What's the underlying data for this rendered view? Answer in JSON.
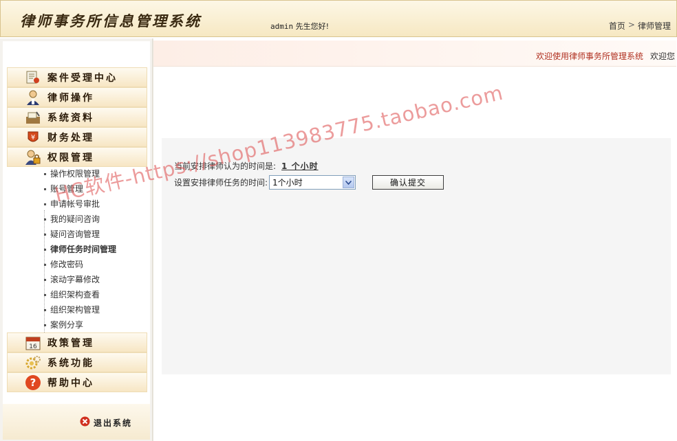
{
  "header": {
    "title": "律师事务所信息管理系统",
    "greeting_user": "admin",
    "greeting_text": "先生您好!",
    "breadcrumb": {
      "home": "首页",
      "separator": ">",
      "current": "律师管理"
    }
  },
  "sidebar": {
    "menus": [
      {
        "label": "案件受理中心",
        "icon": "case-icon"
      },
      {
        "label": "律师操作",
        "icon": "lawyer-icon"
      },
      {
        "label": "系统资料",
        "icon": "system-data-icon"
      },
      {
        "label": "财务处理",
        "icon": "finance-icon"
      },
      {
        "label": "权限管理",
        "icon": "permission-icon"
      },
      {
        "label": "政策管理",
        "icon": "calendar-icon"
      },
      {
        "label": "系统功能",
        "icon": "gear-icon"
      },
      {
        "label": "帮助中心",
        "icon": "help-icon"
      }
    ],
    "submenu": [
      "操作权限管理",
      "账号管理",
      "申请帐号审批",
      "我的疑问咨询",
      "疑问咨询管理",
      "律师任务时间管理",
      "修改密码",
      "滚动字幕修改",
      "组织架构查看",
      "组织架构管理",
      "案例分享"
    ],
    "active_submenu": "律师任务时间管理",
    "logout_label": "退出系统"
  },
  "main": {
    "marquee_text": "欢迎使用律师事务所管理系统",
    "marquee_more": "欢迎您",
    "current_label": "当前安排律师认为的时间是:",
    "current_value": "1 个小时",
    "set_label": "设置安排律师任务的时间:",
    "select_value": "1个小时",
    "submit_label": "确认提交"
  },
  "watermark": "HC软件-https://shop113983775.taobao.com",
  "colors": {
    "header_bg": "#f6e8c2",
    "marquee_text": "#b03020",
    "watermark": "#e06060"
  }
}
